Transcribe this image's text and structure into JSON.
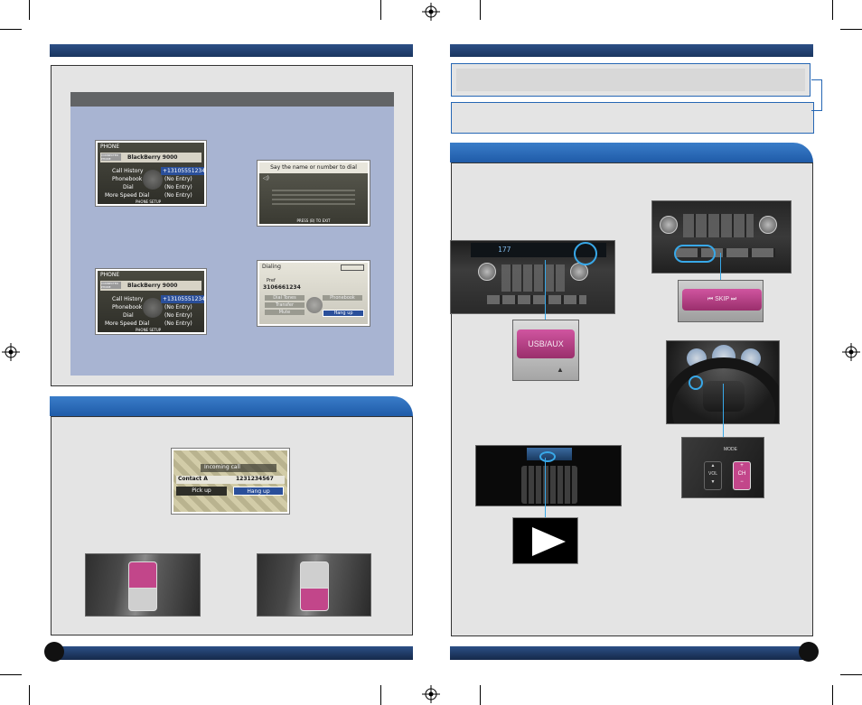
{
  "colors": {
    "navy": "#1a355f",
    "tab_blue": "#2566b4",
    "panel_bg": "#e4e4e4",
    "lavender": "#a8b4d2",
    "accent_pink": "#c2468a",
    "cyan_ring": "#38a8e8"
  },
  "phone_menu_1": {
    "title": "PHONE",
    "connected_label": "CONNECTED PHONE",
    "device": "BlackBerry 9000",
    "rows": [
      {
        "label": "Call History",
        "value": "+13105551234"
      },
      {
        "label": "Phonebook",
        "value": "(No Entry)"
      },
      {
        "label": "Dial",
        "value": "(No Entry)"
      },
      {
        "label": "More Speed Dial",
        "value": "(No Entry)"
      }
    ],
    "footer": "PHONE SETUP"
  },
  "phone_menu_2": {
    "title": "PHONE",
    "connected_label": "CONNECTED PHONE",
    "device": "BlackBerry 9000",
    "rows": [
      {
        "label": "Call History",
        "value": "+13105551234"
      },
      {
        "label": "Phonebook",
        "value": "(No Entry)"
      },
      {
        "label": "Dial",
        "value": "(No Entry)"
      },
      {
        "label": "More Speed Dial",
        "value": "(No Entry)"
      }
    ],
    "footer": "PHONE SETUP"
  },
  "voice_dial": {
    "title": "Say the name or number to dial",
    "footer": "PRESS (B) TO EXIT"
  },
  "dialing": {
    "title": "Dialing",
    "caller": "Pref",
    "number": "3106661234",
    "buttons": [
      "Dial Tones",
      "Phonebook",
      "Transfer",
      "Mute",
      "Hang up"
    ]
  },
  "incoming": {
    "title": "Incoming call",
    "contact": "Contact A",
    "number": "1231234567",
    "pickup": "Pick up",
    "hangup": "Hang up"
  },
  "usb_label": "USB/AUX",
  "skip_label": "SKIP",
  "wheel": {
    "mode": "MODE",
    "vol": "VOL",
    "ch": "CH"
  },
  "radio_display": "177"
}
